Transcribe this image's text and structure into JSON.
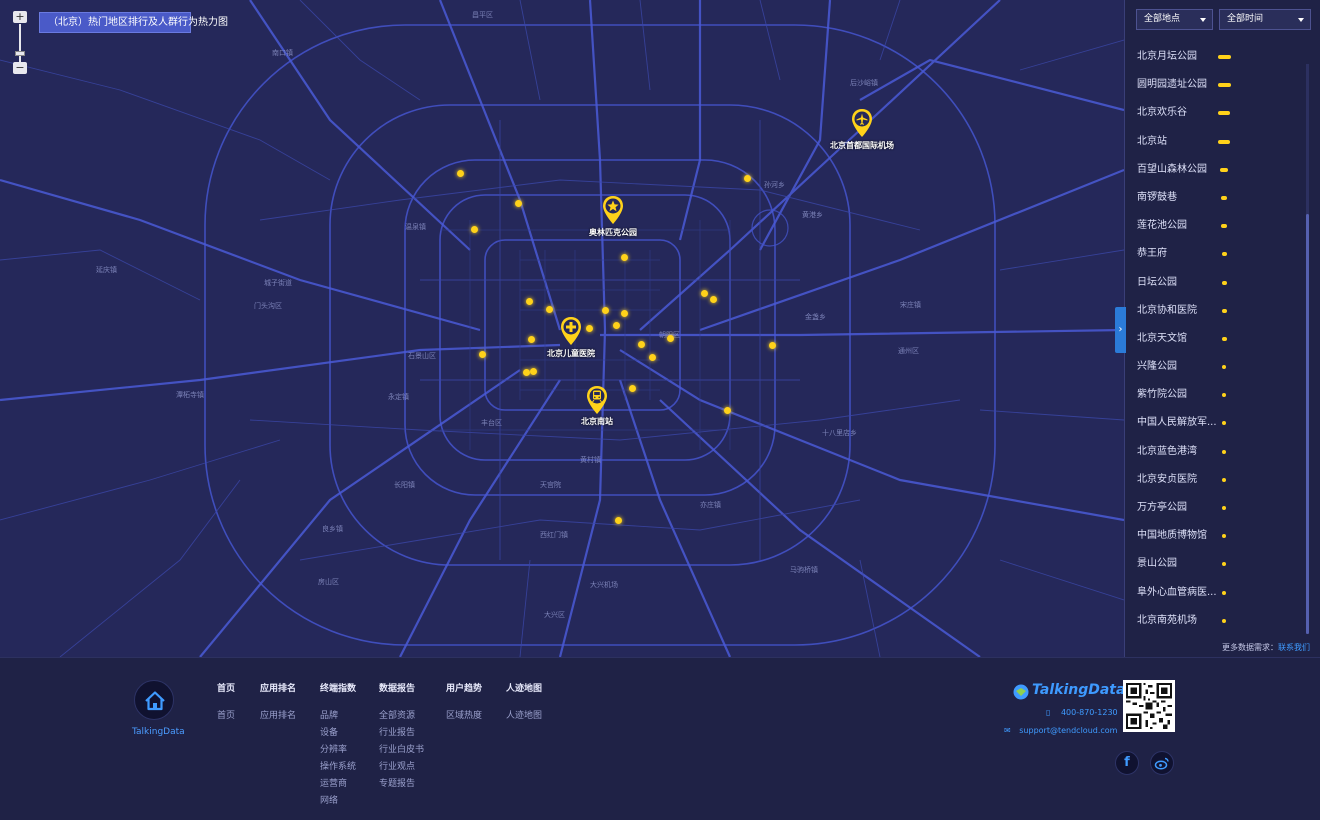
{
  "map": {
    "title": "（北京）热门地区排行及人群行为热力图",
    "pins": [
      {
        "label": "北京首都国际机场",
        "icon": "airplane-icon"
      },
      {
        "label": "奥林匹克公园",
        "icon": "star-icon"
      },
      {
        "label": "北京儿童医院",
        "icon": "hospital-icon"
      },
      {
        "label": "北京南站",
        "icon": "train-icon"
      }
    ],
    "district_labels": [
      "石景山区",
      "丰台区",
      "朝阳区",
      "门头沟区",
      "大兴区",
      "房山区",
      "昌平区",
      "通州区"
    ],
    "place_labels": [
      "延庆镇",
      "大兴机场",
      "天宫院",
      "黄村镇",
      "亦庄镇",
      "宋庄镇",
      "南口镇",
      "温泉镇",
      "孙河乡",
      "后沙峪镇",
      "金盏乡",
      "十八里店乡",
      "马驹桥镇",
      "西红门镇",
      "长阳镇",
      "良乡镇",
      "永定镇",
      "潭柘寺镇",
      "城子街道",
      "黄港乡"
    ],
    "colors": {
      "background": "#25285a",
      "roads": "#4352c7",
      "pin": "#ffd21a"
    }
  },
  "side": {
    "location_select": "全部地点",
    "time_select": "全部时间",
    "ranking": [
      {
        "name": "北京月坛公园",
        "value": 1.0
      },
      {
        "name": "圆明园遗址公园",
        "value": 1.0
      },
      {
        "name": "北京欢乐谷",
        "value": 0.95
      },
      {
        "name": "北京站",
        "value": 0.95
      },
      {
        "name": "百望山森林公园",
        "value": 0.6
      },
      {
        "name": "南锣鼓巷",
        "value": 0.45
      },
      {
        "name": "莲花池公园",
        "value": 0.45
      },
      {
        "name": "恭王府",
        "value": 0.4
      },
      {
        "name": "日坛公园",
        "value": 0.38
      },
      {
        "name": "北京协和医院",
        "value": 0.35
      },
      {
        "name": "北京天文馆",
        "value": 0.35
      },
      {
        "name": "兴隆公园",
        "value": 0.3
      },
      {
        "name": "紫竹院公园",
        "value": 0.3
      },
      {
        "name": "中国人民解放军...",
        "value": 0.3
      },
      {
        "name": "北京蓝色港湾",
        "value": 0.3
      },
      {
        "name": "北京安贞医院",
        "value": 0.3
      },
      {
        "name": "万方亭公园",
        "value": 0.3
      },
      {
        "name": "中国地质博物馆",
        "value": 0.3
      },
      {
        "name": "景山公园",
        "value": 0.3
      },
      {
        "name": "阜外心血管病医...",
        "value": 0.3
      },
      {
        "name": "北京南苑机场",
        "value": 0.3
      }
    ],
    "more_text": "更多数据需求：",
    "more_link": "联系我们"
  },
  "footer": {
    "logo_text": "TalkingData",
    "columns": [
      {
        "head": "首页",
        "links": [
          "首页"
        ]
      },
      {
        "head": "应用排名",
        "links": [
          "应用排名"
        ]
      },
      {
        "head": "终端指数",
        "links": [
          "品牌",
          "设备",
          "分辨率",
          "操作系统",
          "运营商",
          "网络"
        ]
      },
      {
        "head": "数据报告",
        "links": [
          "全部资源",
          "行业报告",
          "行业白皮书",
          "行业观点",
          "专题报告"
        ]
      },
      {
        "head": "用户趋势",
        "links": [
          "区域热度"
        ]
      },
      {
        "head": "人迹地图",
        "links": [
          "人迹地图"
        ]
      }
    ],
    "brand": "TalkingData",
    "phone": "400-870-1230",
    "email": "support@tendcloud.com",
    "social": [
      "facebook-icon",
      "weibo-icon"
    ]
  }
}
